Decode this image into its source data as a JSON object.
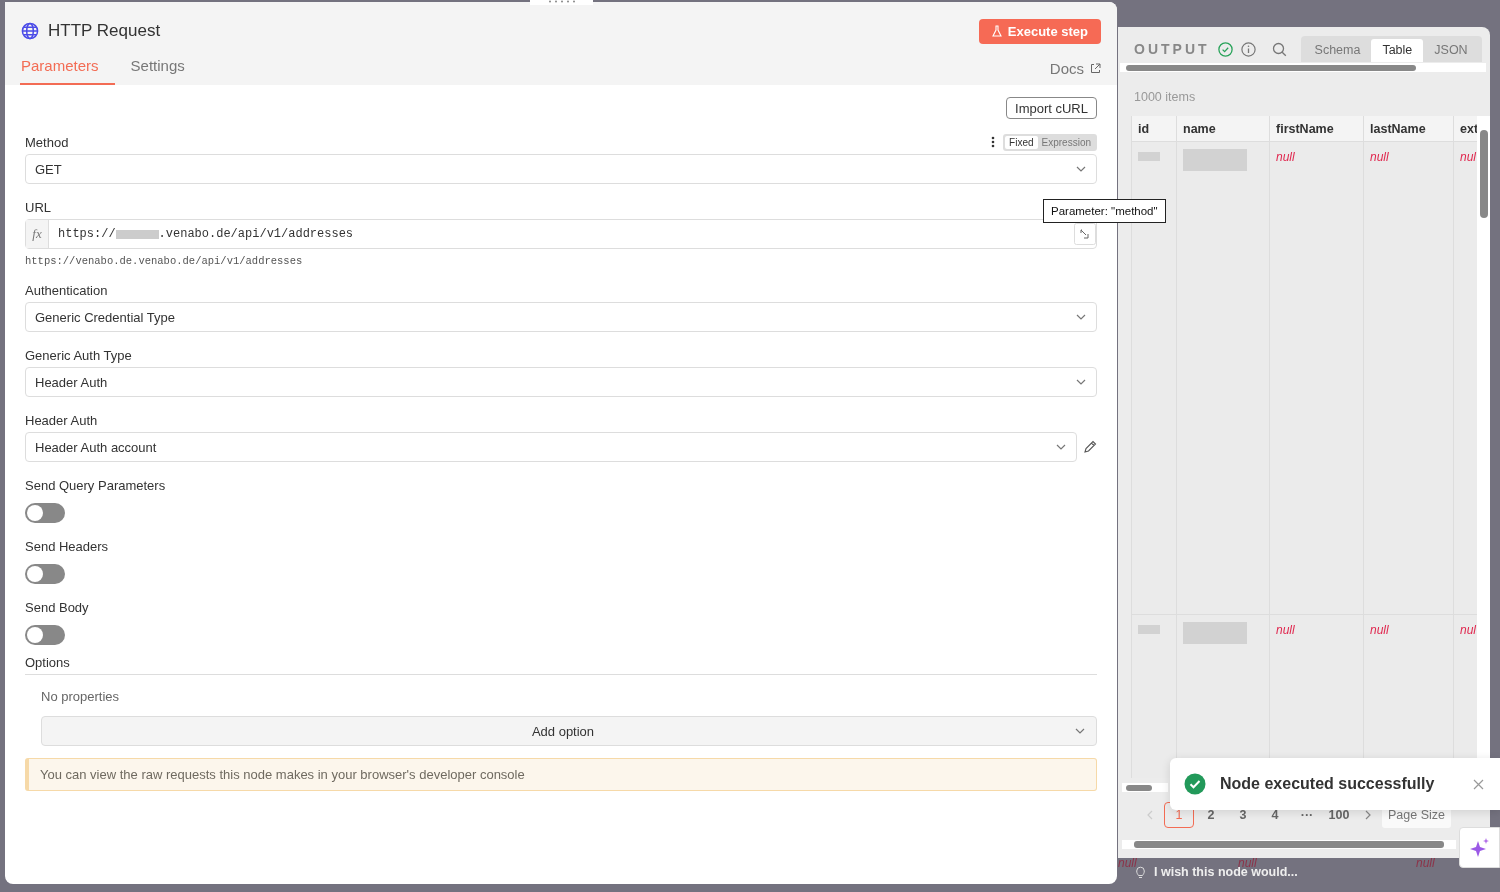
{
  "node": {
    "title": "HTTP Request",
    "execute_button": "Execute step",
    "docs_link": "Docs",
    "tabs": [
      {
        "label": "Parameters",
        "selected": true
      },
      {
        "label": "Settings",
        "selected": false
      }
    ]
  },
  "import_button": "Import cURL",
  "parameters": [
    {
      "kind": "select",
      "label": "Method",
      "value": "GET",
      "modes": [
        {
          "label": "Fixed",
          "selected": true
        },
        {
          "label": "Expression",
          "selected": false
        }
      ]
    },
    {
      "kind": "expression",
      "label": "URL",
      "prefix": "fx",
      "value_start": "https://",
      "value_end": ".venabo.de/api/v1/addresses",
      "preview": "https://venabo.de.venabo.de/api/v1/addresses"
    },
    {
      "kind": "select",
      "label": "Authentication",
      "value": "Generic Credential Type"
    },
    {
      "kind": "select",
      "label": "Generic Auth Type",
      "value": "Header Auth"
    },
    {
      "kind": "credential",
      "label": "Header Auth",
      "value": "Header Auth account"
    },
    {
      "kind": "toggle",
      "label": "Send Query Parameters",
      "on": false
    },
    {
      "kind": "toggle",
      "label": "Send Headers",
      "on": false
    },
    {
      "kind": "toggle",
      "label": "Send Body",
      "on": false
    }
  ],
  "options": {
    "label": "Options",
    "empty_text": "No properties",
    "add_button": "Add option"
  },
  "notice": "You can view the raw requests this node makes in your browser's developer console",
  "tooltip": "Parameter: \"method\"",
  "output": {
    "title": "OUTPUT",
    "views": [
      {
        "label": "Schema",
        "selected": false
      },
      {
        "label": "Table",
        "selected": true
      },
      {
        "label": "JSON",
        "selected": false
      }
    ],
    "item_count": "1000 items",
    "table": {
      "columns": [
        "id",
        "name",
        "firstName",
        "lastName",
        "ext"
      ],
      "rows": [
        [
          {
            "redacted": true
          },
          {
            "redacted": true
          },
          {
            "redacted": false,
            "text": "null"
          },
          {
            "redacted": false,
            "text": "null"
          },
          {
            "redacted": false,
            "text": "nul"
          }
        ],
        [
          {
            "redacted": true
          },
          {
            "redacted": true
          },
          {
            "redacted": false,
            "text": "null"
          },
          {
            "redacted": false,
            "text": "null"
          },
          {
            "redacted": false,
            "text": "nul"
          }
        ]
      ]
    },
    "pagination": {
      "pages": [
        {
          "label": "1",
          "selected": true
        },
        {
          "label": "2",
          "selected": false
        },
        {
          "label": "3",
          "selected": false
        },
        {
          "label": "4",
          "selected": false
        },
        {
          "label": "···",
          "selected": false
        },
        {
          "label": "100",
          "selected": false
        }
      ],
      "page_size_label": "Page Size"
    }
  },
  "toast": {
    "message": "Node executed successfully"
  },
  "background": {
    "feedback_prompt": "I wish this node would...",
    "null_labels": [
      "null",
      "null",
      "null"
    ]
  }
}
